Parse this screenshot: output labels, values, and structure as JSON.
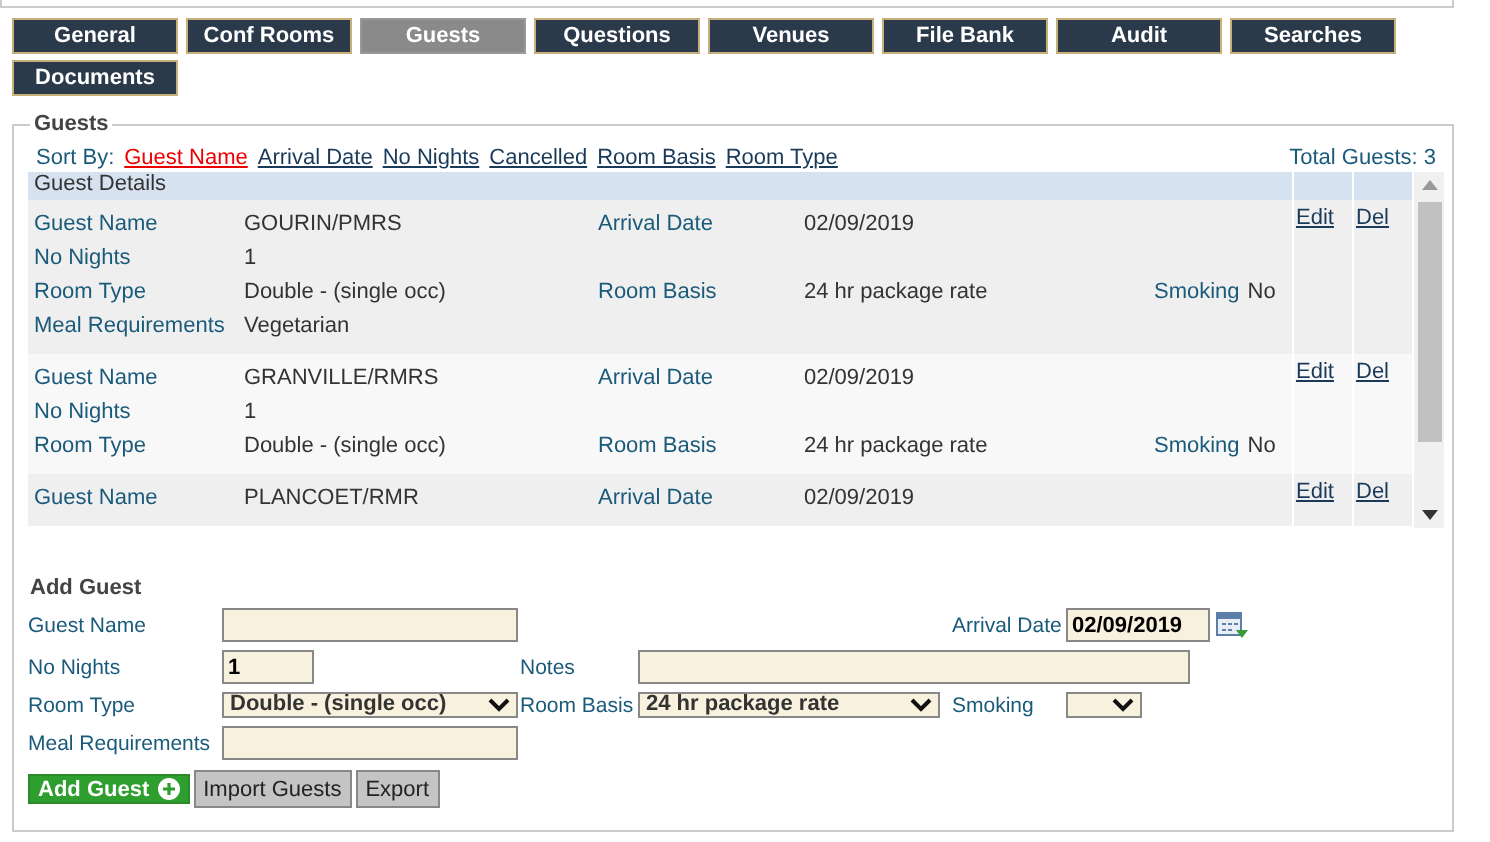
{
  "tabs": [
    {
      "label": "General",
      "selected": false
    },
    {
      "label": "Conf Rooms",
      "selected": false
    },
    {
      "label": "Guests",
      "selected": true
    },
    {
      "label": "Questions",
      "selected": false
    },
    {
      "label": "Venues",
      "selected": false
    },
    {
      "label": "File Bank",
      "selected": false
    },
    {
      "label": "Audit",
      "selected": false
    },
    {
      "label": "Searches",
      "selected": false
    },
    {
      "label": "Documents",
      "selected": false
    }
  ],
  "guests": {
    "legend": "Guests",
    "sort_label": "Sort By:",
    "sort_options": [
      {
        "label": "Guest Name",
        "selected": true
      },
      {
        "label": "Arrival Date",
        "selected": false
      },
      {
        "label": "No Nights",
        "selected": false
      },
      {
        "label": "Cancelled",
        "selected": false
      },
      {
        "label": "Room Basis",
        "selected": false
      },
      {
        "label": "Room Type",
        "selected": false
      }
    ],
    "total": "Total Guests: 3",
    "header": "Guest Details",
    "records": [
      {
        "lines": [
          [
            {
              "label": "Guest Name",
              "value": "GOURIN/PMRS"
            },
            {
              "label": "Arrival Date",
              "value": "02/09/2019"
            }
          ],
          [
            {
              "label": "No Nights",
              "value": "1"
            }
          ],
          [
            {
              "label": "Room Type",
              "value": "Double - (single occ)"
            },
            {
              "label": "Room Basis",
              "value": "24 hr package rate"
            },
            {
              "label": "Smoking",
              "value": "No"
            }
          ],
          [
            {
              "label": "Meal Requirements",
              "value": "Vegetarian"
            }
          ]
        ],
        "edit": "Edit",
        "del": "Del"
      },
      {
        "lines": [
          [
            {
              "label": "Guest Name",
              "value": "GRANVILLE/RMRS"
            },
            {
              "label": "Arrival Date",
              "value": "02/09/2019"
            }
          ],
          [
            {
              "label": "No Nights",
              "value": "1"
            }
          ],
          [
            {
              "label": "Room Type",
              "value": "Double - (single occ)"
            },
            {
              "label": "Room Basis",
              "value": "24 hr package rate"
            },
            {
              "label": "Smoking",
              "value": "No"
            }
          ]
        ],
        "edit": "Edit",
        "del": "Del"
      },
      {
        "lines": [
          [
            {
              "label": "Guest Name",
              "value": "PLANCOET/RMR"
            },
            {
              "label": "Arrival Date",
              "value": "02/09/2019"
            }
          ]
        ],
        "edit": "Edit",
        "del": "Del"
      }
    ]
  },
  "add_guest": {
    "title": "Add Guest",
    "guest_name": {
      "label": "Guest Name"
    },
    "arrival_date": {
      "label": "Arrival Date",
      "value": "02/09/2019"
    },
    "no_nights": {
      "label": "No Nights",
      "value": "1"
    },
    "notes": {
      "label": "Notes"
    },
    "room_type": {
      "label": "Room Type",
      "value": "Double - (single occ)"
    },
    "room_basis": {
      "label": "Room Basis",
      "value": "24 hr package rate"
    },
    "smoking": {
      "label": "Smoking"
    },
    "meal": {
      "label": "Meal Requirements"
    },
    "buttons": [
      {
        "label": "Add Guest",
        "kind": "primary"
      },
      {
        "label": "Import Guests",
        "kind": "secondary"
      },
      {
        "label": "Export",
        "kind": "secondary"
      }
    ]
  }
}
